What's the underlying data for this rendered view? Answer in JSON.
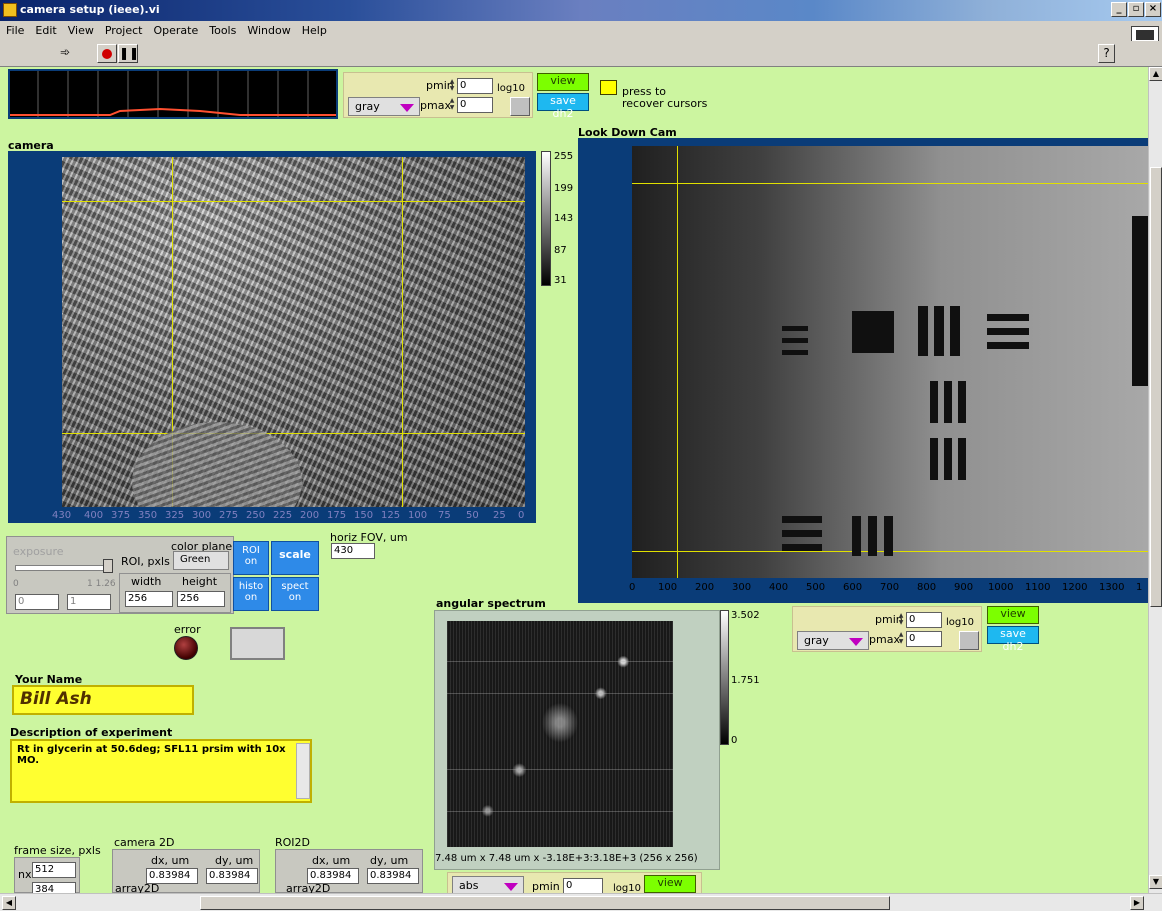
{
  "window": {
    "title": "camera setup (ieee).vi"
  },
  "menu": [
    "File",
    "Edit",
    "View",
    "Project",
    "Operate",
    "Tools",
    "Window",
    "Help"
  ],
  "toolbar": {
    "help": "?"
  },
  "histogram_controls": {
    "colormap": "gray",
    "pmin_label": "pmin",
    "pmin": "0",
    "pmax_label": "pmax",
    "pmax": "0",
    "log_label": "log10",
    "view_label": "view",
    "save_label": "save dh2"
  },
  "recover": {
    "text1": "press to",
    "text2": "recover cursors"
  },
  "camera": {
    "title": "camera",
    "colorbar_ticks": [
      "255",
      "199",
      "143",
      "87",
      "31"
    ],
    "x_ticks": [
      "430",
      "400",
      "375",
      "350",
      "325",
      "300",
      "275",
      "250",
      "225",
      "200",
      "175",
      "150",
      "125",
      "100",
      "75",
      "50",
      "25",
      "0"
    ]
  },
  "lookdown": {
    "title": "Look Down Cam",
    "x_ticks": [
      "0",
      "100",
      "200",
      "300",
      "400",
      "500",
      "600",
      "700",
      "800",
      "900",
      "1000",
      "1100",
      "1200",
      "1300",
      "1"
    ],
    "colormap": "gray",
    "pmin_label": "pmin",
    "pmin": "0",
    "pmax_label": "pmax",
    "pmax": "0",
    "log_label": "log10",
    "view_label": "view",
    "save_label": "save dh2"
  },
  "camera_controls": {
    "exposure_label": "exposure",
    "exp_min": "0",
    "exp_max": "1 1.26",
    "exp_a": "0",
    "exp_b": "1",
    "roi_label": "ROI, pxls",
    "color_plane_label": "color plane",
    "color_plane": "Green",
    "width_label": "width",
    "width": "256",
    "height_label": "height",
    "height": "256",
    "roi_btn": [
      "ROI",
      "on"
    ],
    "scale_btn": "scale",
    "histo_btn": [
      "histo",
      "on"
    ],
    "spect_btn": [
      "spect",
      "on"
    ],
    "fov_label": "horiz FOV, um",
    "fov": "430"
  },
  "error": {
    "label": "error"
  },
  "your_name": {
    "label": "Your Name",
    "value": "Bill Ash"
  },
  "description": {
    "label": "Description of experiment",
    "value": "Rt in glycerin at 50.6deg; SFL11 prsim with 10x MO."
  },
  "frame": {
    "label": "frame size, pxls",
    "nx_label": "nx",
    "nx": "512",
    "ny": "384"
  },
  "camera2d": {
    "label": "camera 2D",
    "dx_label": "dx, um",
    "dx": "0.83984",
    "dy_label": "dy, um",
    "dy": "0.83984",
    "array_label": "array2D"
  },
  "roi2d": {
    "label": "ROI2D",
    "dx_label": "dx, um",
    "dx": "0.83984",
    "dy_label": "dy, um",
    "dy": "0.83984",
    "array_label": "array2D"
  },
  "spectrum": {
    "title": "angular spectrum",
    "colorbar_ticks": [
      "3.502",
      "1.751",
      "0"
    ],
    "caption": "7.48 um x 7.48 um x -3.18E+3:3.18E+3 (256 x 256)",
    "colormap": "abs",
    "pmin_label": "pmin",
    "pmin": "0",
    "log_label": "log10",
    "view_label": "view"
  }
}
